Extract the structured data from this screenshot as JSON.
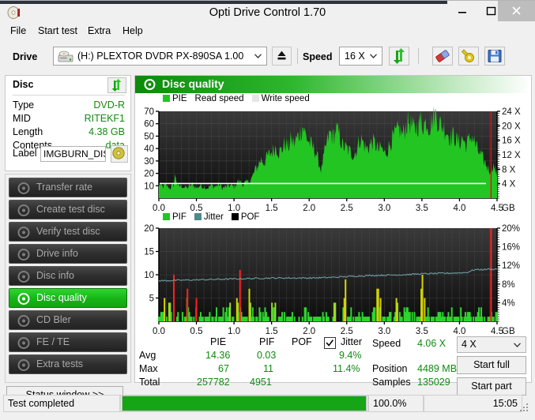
{
  "window": {
    "title": "Opti Drive Control 1.70",
    "icon": "disc-icon",
    "minimize_label": "–",
    "maximize_label": "□",
    "close_label": "×"
  },
  "menu": {
    "items": [
      {
        "label": "File"
      },
      {
        "label": "Start test"
      },
      {
        "label": "Extra"
      },
      {
        "label": "Help"
      }
    ]
  },
  "toolbar": {
    "drive_label": "Drive",
    "drive_value": "(H:)  PLEXTOR DVDR  PX-890SA 1.00",
    "eject_icon": "eject-icon",
    "speed_label": "Speed",
    "speed_value": "16 X",
    "refresh_icon": "refresh-arrows-icon",
    "erase_icon": "eraser-icon",
    "tools_icon": "wrench-gear-icon",
    "save_icon": "floppy-save-icon"
  },
  "disc": {
    "title": "Disc",
    "refresh_icon": "refresh-arrows-icon",
    "rows": [
      {
        "key": "Type",
        "value": "DVD-R"
      },
      {
        "key": "MID",
        "value": "RITEKF1"
      },
      {
        "key": "Length",
        "value": "4.38 GB"
      },
      {
        "key": "Contents",
        "value": "data"
      }
    ],
    "label_key": "Label",
    "label_value": "IMGBURN_DIS",
    "label_button_icon": "disc-icon"
  },
  "sidebar": {
    "items": [
      {
        "label": "Transfer rate",
        "icon": "disc-test-icon",
        "active": false
      },
      {
        "label": "Create test disc",
        "icon": "disc-test-icon",
        "active": false
      },
      {
        "label": "Verify test disc",
        "icon": "disc-test-icon",
        "active": false
      },
      {
        "label": "Drive info",
        "icon": "disc-test-icon",
        "active": false
      },
      {
        "label": "Disc info",
        "icon": "disc-test-icon",
        "active": false
      },
      {
        "label": "Disc quality",
        "icon": "disc-test-icon",
        "active": true
      },
      {
        "label": "CD Bler",
        "icon": "disc-test-icon",
        "active": false
      },
      {
        "label": "FE / TE",
        "icon": "disc-test-icon",
        "active": false
      },
      {
        "label": "Extra tests",
        "icon": "disc-test-icon",
        "active": false
      }
    ],
    "status_window_label": "Status window >>"
  },
  "main": {
    "header_title": "Disc quality",
    "header_icon": "disc-test-icon"
  },
  "chart_data": [
    {
      "type": "area",
      "name": "pie-chart",
      "title": "",
      "xlabel": "GB",
      "ylabel": "",
      "xlim": [
        0.0,
        4.5
      ],
      "ylim": [
        0,
        70
      ],
      "y2lim": [
        0,
        24
      ],
      "y2label": "X",
      "grid": true,
      "legend_position": "top-left",
      "legend": [
        {
          "name": "PIE",
          "color": "#22c522"
        },
        {
          "name": "Read speed",
          "color": "#ffffff"
        },
        {
          "name": "Write speed",
          "color": "#dcdcdc"
        }
      ],
      "xticks": [
        "0.0",
        "0.5",
        "1.0",
        "1.5",
        "2.0",
        "2.5",
        "3.0",
        "3.5",
        "4.0",
        "4.5"
      ],
      "yticks": [
        10,
        20,
        30,
        40,
        50,
        60,
        70
      ],
      "y2ticks": [
        "4 X",
        "8 X",
        "12 X",
        "16 X",
        "20 X",
        "24 X"
      ],
      "series": [
        {
          "name": "PIE",
          "color": "#22c522",
          "x": [
            0.0,
            0.05,
            0.1,
            0.15,
            0.2,
            0.22,
            0.25,
            0.3,
            0.35,
            0.4,
            0.45,
            0.5,
            0.55,
            0.6,
            0.65,
            0.7,
            0.75,
            0.8,
            0.85,
            0.9,
            0.95,
            1.0,
            1.05,
            1.08,
            1.12,
            1.16,
            1.2,
            1.24,
            1.28,
            1.32,
            1.36,
            1.4,
            1.44,
            1.48,
            1.52,
            1.56,
            1.6,
            1.64,
            1.68,
            1.72,
            1.76,
            1.8,
            1.84,
            1.88,
            1.92,
            1.96,
            2.0,
            2.04,
            2.08,
            2.12,
            2.16,
            2.2,
            2.24,
            2.28,
            2.32,
            2.36,
            2.4,
            2.44,
            2.48,
            2.52,
            2.56,
            2.6,
            2.64,
            2.68,
            2.72,
            2.76,
            2.8,
            2.84,
            2.88,
            2.92,
            2.96,
            3.0,
            3.04,
            3.08,
            3.12,
            3.16,
            3.2,
            3.24,
            3.28,
            3.32,
            3.36,
            3.4,
            3.44,
            3.48,
            3.52,
            3.56,
            3.6,
            3.64,
            3.68,
            3.72,
            3.76,
            3.8,
            3.84,
            3.88,
            3.92,
            3.96,
            4.0,
            4.04,
            4.08,
            4.12,
            4.16,
            4.2,
            4.24,
            4.28,
            4.32,
            4.36,
            4.4,
            4.45,
            4.5
          ],
          "values": [
            11,
            9,
            10,
            8,
            11,
            19,
            9,
            10,
            8,
            9,
            11,
            8,
            10,
            9,
            8,
            10,
            9,
            11,
            8,
            9,
            10,
            9,
            13,
            13,
            11,
            12,
            13,
            16,
            22,
            26,
            31,
            28,
            33,
            35,
            38,
            41,
            36,
            39,
            44,
            40,
            47,
            43,
            48,
            52,
            57,
            49,
            44,
            41,
            38,
            30,
            22,
            34,
            45,
            52,
            48,
            55,
            50,
            42,
            40,
            38,
            36,
            34,
            40,
            48,
            44,
            39,
            41,
            45,
            43,
            38,
            40,
            35,
            38,
            44,
            48,
            52,
            55,
            50,
            56,
            61,
            58,
            54,
            57,
            62,
            58,
            61,
            56,
            63,
            67,
            60,
            58,
            55,
            52,
            48,
            50,
            46,
            44,
            48,
            42,
            45,
            50,
            44,
            38,
            34,
            30,
            26,
            22,
            26,
            18
          ]
        },
        {
          "name": "Read speed",
          "color": "#ffffff",
          "x": [
            0.0,
            0.5,
            1.0,
            1.5,
            2.0,
            2.5,
            3.0,
            3.5,
            4.0,
            4.5
          ],
          "values": [
            4.06,
            4.06,
            4.06,
            4.06,
            4.06,
            4.06,
            4.06,
            4.06,
            4.06,
            4.06
          ],
          "axis": "y2"
        }
      ]
    },
    {
      "type": "bar",
      "name": "pif-chart",
      "title": "",
      "xlabel": "GB",
      "ylabel": "",
      "xlim": [
        0.0,
        4.5
      ],
      "ylim": [
        0,
        20
      ],
      "y2lim": [
        0,
        20
      ],
      "y2label": "%",
      "grid": true,
      "legend_position": "top-left",
      "legend": [
        {
          "name": "PIF",
          "color": "#22c522"
        },
        {
          "name": "Jitter",
          "color": "#4e8a8a"
        },
        {
          "name": "POF",
          "color": "#000000"
        }
      ],
      "xticks": [
        "0.0",
        "0.5",
        "1.0",
        "1.5",
        "2.0",
        "2.5",
        "3.0",
        "3.5",
        "4.0",
        "4.5"
      ],
      "yticks": [
        5,
        10,
        15,
        20
      ],
      "y2ticks": [
        "4%",
        "8%",
        "12%",
        "16%",
        "20%"
      ],
      "series": [
        {
          "name": "PIF",
          "color": "#22c522",
          "x": [
            0.03,
            0.07,
            0.1,
            0.13,
            0.17,
            0.2,
            0.23,
            0.27,
            0.3,
            0.33,
            0.37,
            0.4,
            0.43,
            0.47,
            0.5,
            0.55,
            0.6,
            0.65,
            0.7,
            0.75,
            0.8,
            0.85,
            0.9,
            0.95,
            1.0,
            1.05,
            1.08,
            1.12,
            1.18,
            1.23,
            1.28,
            1.33,
            1.38,
            1.43,
            1.5,
            1.57,
            1.63,
            1.7,
            1.77,
            1.85,
            1.92,
            2.0,
            2.08,
            2.15,
            2.2,
            2.25,
            2.32,
            2.38,
            2.42,
            2.5,
            2.58,
            2.65,
            2.72,
            2.8,
            2.88,
            2.95,
            3.02,
            3.08,
            3.15,
            3.22,
            3.28,
            3.32,
            3.38,
            3.42,
            3.48,
            3.55,
            3.62,
            3.7,
            3.78,
            3.85,
            3.92,
            4.0,
            4.08,
            4.15,
            4.22,
            4.3,
            4.38,
            4.45
          ],
          "values": [
            2,
            4,
            1,
            3,
            2,
            1,
            2,
            1,
            3,
            1,
            7,
            2,
            1,
            5,
            1,
            2,
            1,
            2,
            1,
            2,
            1,
            2,
            3,
            1,
            5,
            3,
            2,
            1,
            5,
            2,
            1,
            4,
            2,
            1,
            3,
            1,
            2,
            1,
            2,
            1,
            4,
            1,
            2,
            2,
            2,
            1,
            4,
            2,
            7,
            2,
            1,
            2,
            1,
            2,
            6,
            1,
            2,
            2,
            4,
            2,
            2,
            2,
            2,
            1,
            7,
            2,
            1,
            2,
            1,
            2,
            1,
            2,
            2,
            1,
            2,
            1,
            2,
            2
          ]
        },
        {
          "name": "POF",
          "color": "#ff2020",
          "x": [
            0.2,
            0.38,
            0.5,
            1.08,
            4.42
          ],
          "values": [
            10,
            7,
            5,
            11,
            20
          ]
        },
        {
          "name": "Jitter",
          "color": "#6f9ba3",
          "x": [
            0.0,
            0.25,
            0.5,
            0.75,
            1.0,
            1.25,
            1.5,
            1.75,
            2.0,
            2.25,
            2.5,
            2.75,
            3.0,
            3.25,
            3.5,
            3.75,
            4.0,
            4.1,
            4.2,
            4.3,
            4.4,
            4.5
          ],
          "values": [
            8.7,
            8.8,
            8.9,
            9.0,
            9.1,
            9.2,
            9.3,
            9.3,
            9.3,
            9.4,
            9.6,
            9.8,
            9.9,
            10.0,
            10.2,
            10.3,
            10.4,
            10.5,
            11.1,
            11.1,
            11.2,
            11.2
          ],
          "axis": "y2"
        }
      ]
    }
  ],
  "stats": {
    "col_headers": [
      "PIE",
      "PIF",
      "POF",
      "Jitter"
    ],
    "jitter_checked": true,
    "rows": [
      {
        "label": "Avg",
        "pie": "14.36",
        "pif": "0.03",
        "pof": "",
        "jitter": "9.4%"
      },
      {
        "label": "Max",
        "pie": "67",
        "pif": "11",
        "pof": "",
        "jitter": "11.4%"
      },
      {
        "label": "Total",
        "pie": "257782",
        "pif": "4951",
        "pof": "",
        "jitter": ""
      }
    ],
    "info": [
      {
        "label": "Speed",
        "value": "4.06 X"
      },
      {
        "label": "Position",
        "value": "4489 MB"
      },
      {
        "label": "Samples",
        "value": "135029"
      }
    ],
    "speed_select": "4 X",
    "start_full_label": "Start full",
    "start_part_label": "Start part"
  },
  "statusbar": {
    "message": "Test completed",
    "progress_text": "100.0%",
    "progress_percent": 100,
    "time": "15:05"
  },
  "colors": {
    "accent_green": "#108a10",
    "chart_green": "#22c522",
    "pof_red": "#ff2020",
    "jitter_teal": "#6f9ba3",
    "plot_bg": "#171717"
  }
}
